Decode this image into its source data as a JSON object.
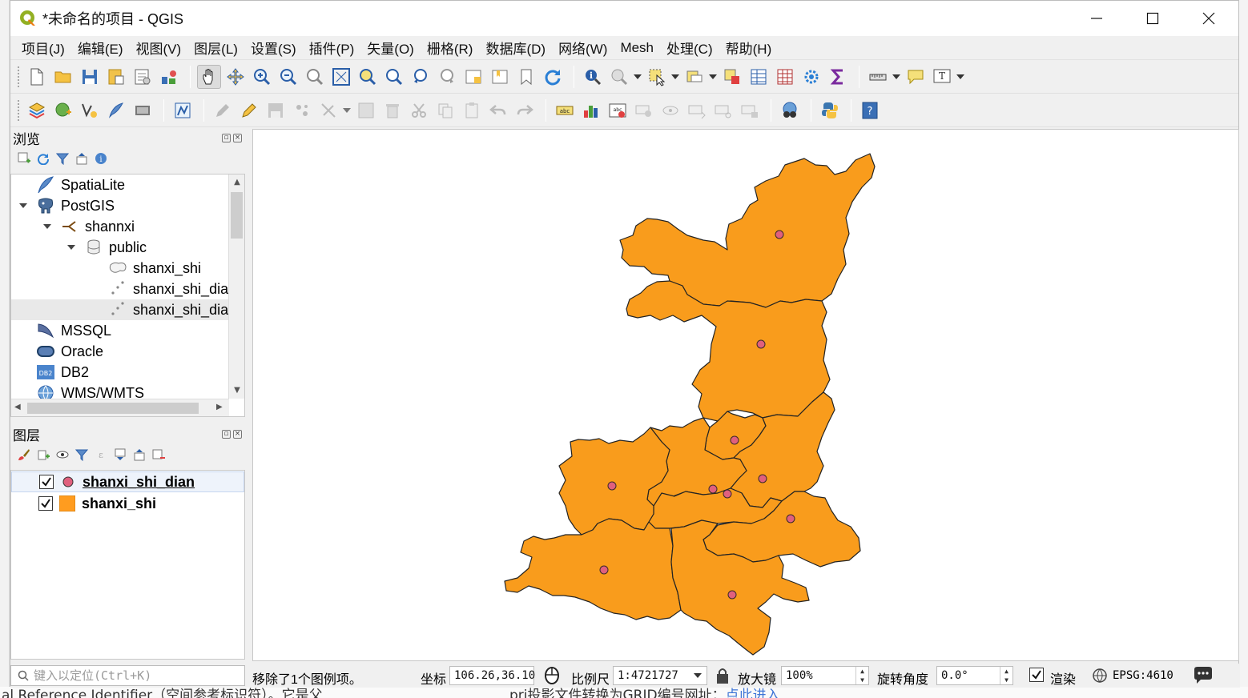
{
  "window": {
    "title": "*未命名的项目 - QGIS"
  },
  "menu": [
    "项目(J)",
    "编辑(E)",
    "视图(V)",
    "图层(L)",
    "设置(S)",
    "插件(P)",
    "矢量(O)",
    "栅格(R)",
    "数据库(D)",
    "网络(W)",
    "Mesh",
    "处理(C)",
    "帮助(H)"
  ],
  "browser": {
    "title": "浏览",
    "items": [
      {
        "label": "SpatiaLite",
        "icon": "spatialite-feather-icon"
      },
      {
        "label": "PostGIS",
        "icon": "postgis-elephant-icon"
      },
      {
        "label": "shannxi",
        "icon": "connection-icon"
      },
      {
        "label": "public",
        "icon": "schema-database-icon"
      },
      {
        "label": "shanxi_shi",
        "icon": "polygon-layer-icon"
      },
      {
        "label": "shanxi_shi_dia",
        "icon": "point-layer-icon"
      },
      {
        "label": "shanxi_shi_dia",
        "icon": "point-layer-icon"
      },
      {
        "label": "MSSQL",
        "icon": "mssql-icon"
      },
      {
        "label": "Oracle",
        "icon": "oracle-icon"
      },
      {
        "label": "DB2",
        "icon": "db2-icon"
      },
      {
        "label": "WMS/WMTS",
        "icon": "wms-globe-icon"
      }
    ]
  },
  "layers": {
    "title": "图层",
    "items": [
      {
        "name": "shanxi_shi_dian",
        "checked": true,
        "symbol": "point",
        "color": "#e0607e"
      },
      {
        "name": "shanxi_shi",
        "checked": true,
        "symbol": "polygon",
        "color": "#ff9c1f"
      }
    ]
  },
  "status": {
    "search_placeholder": "键入以定位(Ctrl+K)",
    "message": "移除了1个图例项。",
    "coord_label": "坐标",
    "coord_value": "106.26,36.10",
    "scale_label": "比例尺",
    "scale_value": "1:4721727",
    "magnifier_label": "放大镜",
    "magnifier_value": "100%",
    "rotation_label": "旋转角度",
    "rotation_value": "0.0°",
    "render_label": "渲染",
    "render_checked": true,
    "crs": "EPSG:4610"
  },
  "map": {
    "fill_color": "#f99c1c",
    "outline_color": "#232323",
    "point_color": "#e0607e",
    "point_count": 11
  },
  "background": {
    "left_text": "al Reference Identifier（空间参考标识符）。它是父",
    "right_text": "prj投影文件转换为GRID编号网址：",
    "link_text": "点此进入"
  }
}
